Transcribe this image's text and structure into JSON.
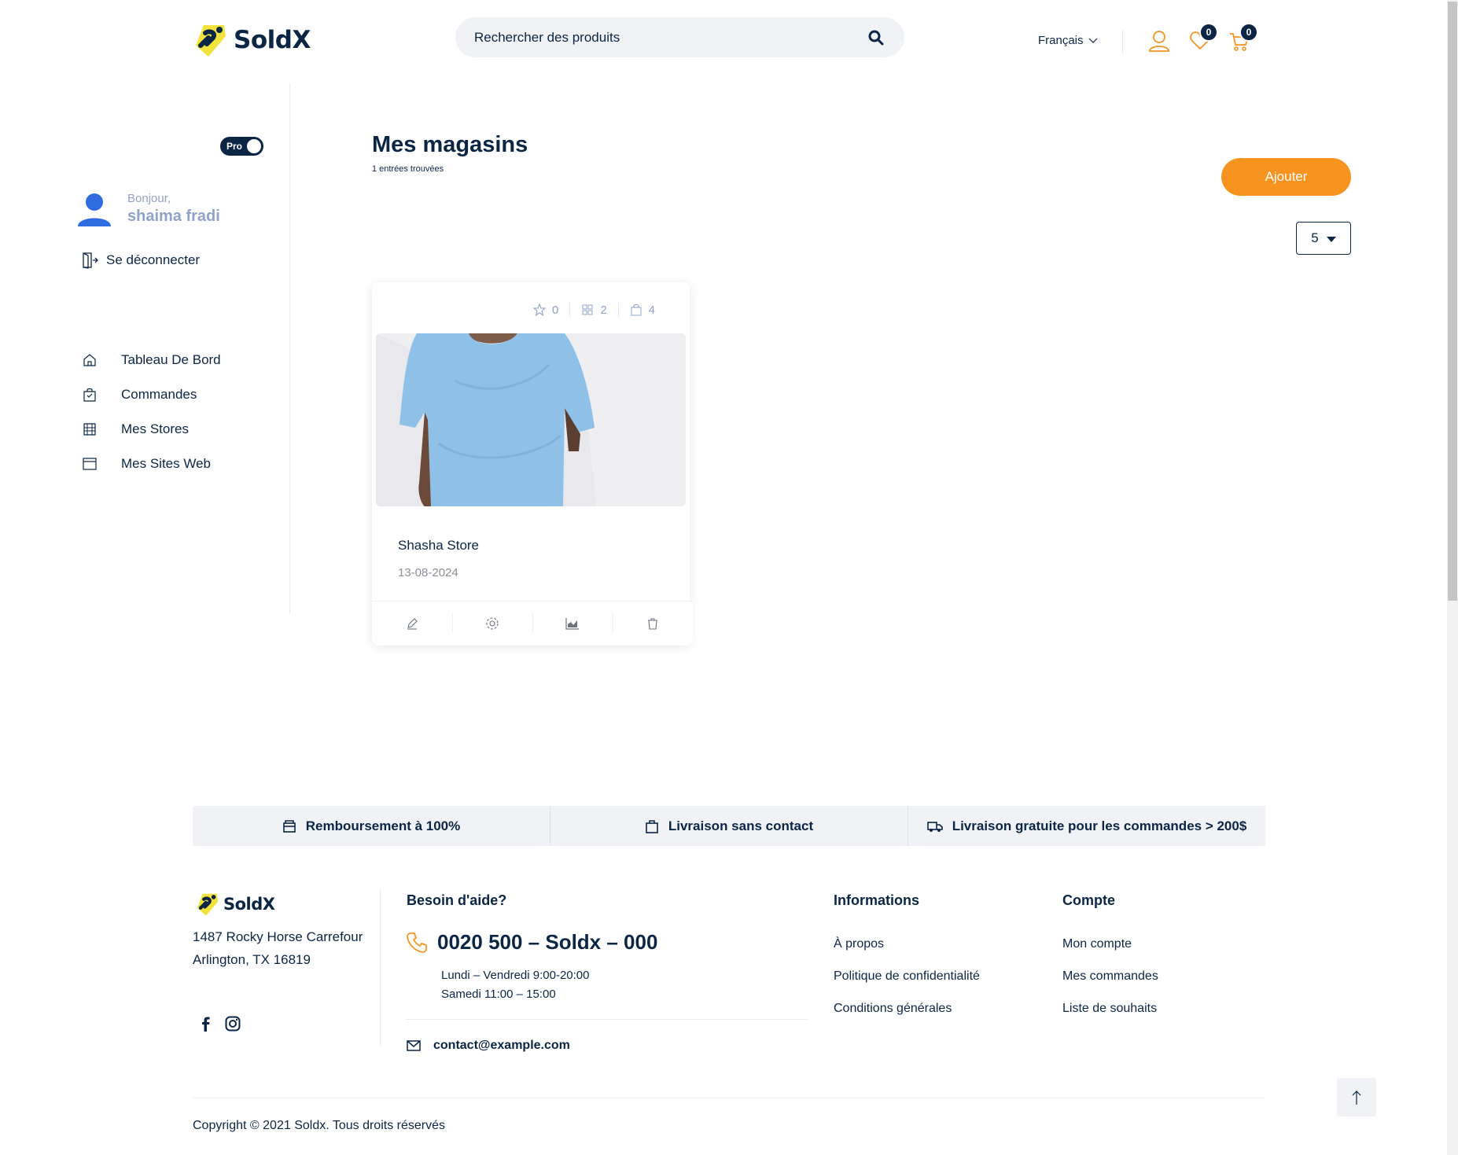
{
  "header": {
    "brand": "SoldX",
    "search_placeholder": "Rechercher des produits",
    "language": "Français",
    "wishlist_count": "0",
    "cart_count": "0"
  },
  "sidebar": {
    "pro_label": "Pro",
    "greeting": "Bonjour,",
    "user_name": "shaima fradi",
    "logout_label": "Se déconnecter",
    "nav": [
      {
        "label": "Tableau De Bord",
        "icon": "home-icon"
      },
      {
        "label": "Commandes",
        "icon": "shopping-bag-icon"
      },
      {
        "label": "Mes Stores",
        "icon": "store-icon"
      },
      {
        "label": "Mes Sites Web",
        "icon": "browser-window-icon"
      }
    ]
  },
  "main": {
    "title": "Mes magasins",
    "subtitle": "1 entrées trouvées",
    "add_label": "Ajouter",
    "per_page": "5",
    "stores": [
      {
        "name": "Shasha Store",
        "date": "13-08-2024",
        "rating": "0",
        "categories": "2",
        "products": "4"
      }
    ]
  },
  "features": [
    {
      "label": "Remboursement à 100%",
      "icon": "wallet-icon"
    },
    {
      "label": "Livraison sans contact",
      "icon": "bag-icon"
    },
    {
      "label": "Livraison gratuite pour les commandes > 200$",
      "icon": "truck-icon"
    }
  ],
  "footer": {
    "brand": "SoldX",
    "address_line1": "1487 Rocky Horse Carrefour",
    "address_line2": "Arlington, TX 16819",
    "help_title": "Besoin d'aide?",
    "phone": "0020 500 – Soldx – 000",
    "hours_line1": "Lundi – Vendredi 9:00-20:00",
    "hours_line2": "Samedi 11:00 – 15:00",
    "email": "contact@example.com",
    "info_title": "Informations",
    "info_links": [
      "À propos",
      "Politique de confidentialité",
      "Conditions générales"
    ],
    "account_title": "Compte",
    "account_links": [
      "Mon compte",
      "Mes commandes",
      "Liste de souhaits"
    ],
    "copyright": "Copyright © 2021 Soldx. Tous droits réservés"
  },
  "colors": {
    "brand_navy": "#0b2545",
    "accent_orange": "#f79420",
    "logo_yellow": "#f2e33c",
    "muted_blue": "#8fa3c7"
  }
}
